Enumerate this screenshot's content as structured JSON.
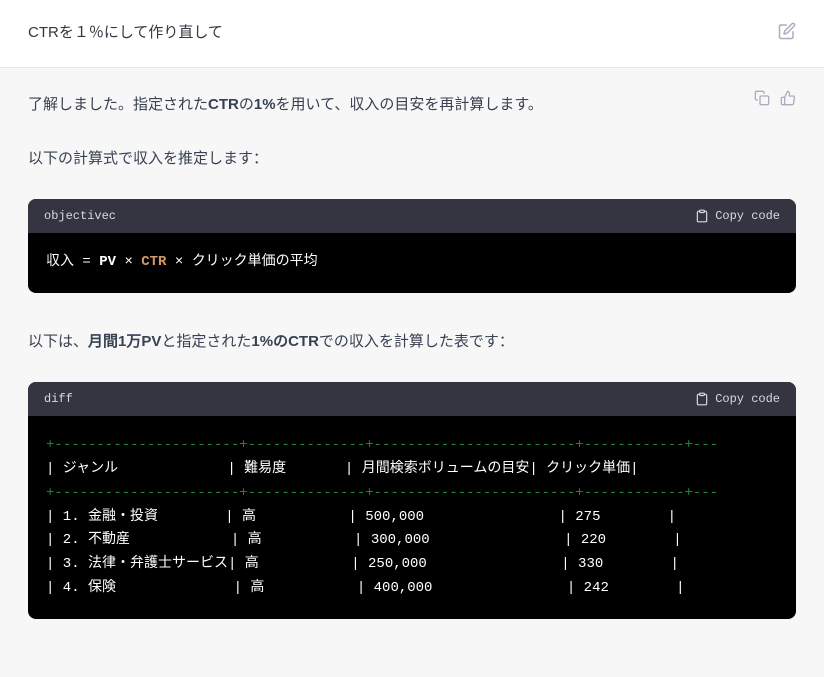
{
  "user": {
    "message": "CTRを１％にして作り直して"
  },
  "assistant": {
    "para1": "了解しました。指定されたCTRの1%を用いて、収入の目安を再計算します。",
    "para2": "以下の計算式で収入を推定します：",
    "para3": "以下は、月間1万PVと指定された1%のCTRでの収入を計算した表です："
  },
  "bold": {
    "ctr": "CTR",
    "one_percent": "1%",
    "pv10k": "月間1万PV",
    "one_percent_ctr": "1%のCTR"
  },
  "code1": {
    "lang": "objectivec",
    "copy": "Copy code",
    "tok_income": "収入",
    "tok_eq": "=",
    "tok_pv": "PV",
    "tok_times1": "×",
    "tok_ctr": "CTR",
    "tok_times2": "×",
    "tok_rest": "クリック単価の平均"
  },
  "code2": {
    "lang": "diff",
    "copy": "Copy code"
  },
  "chart_data": {
    "type": "table",
    "columns": [
      "ジャンル",
      "難易度",
      "月間検索ボリュームの目安",
      "クリック単価"
    ],
    "rows": [
      {
        "no": "1.",
        "genre": "金融・投資",
        "difficulty": "高",
        "volume": "500,000",
        "cpc": "275"
      },
      {
        "no": "2.",
        "genre": "不動産",
        "difficulty": "高",
        "volume": "300,000",
        "cpc": "220"
      },
      {
        "no": "3.",
        "genre": "法律・弁護士サービス",
        "difficulty": "高",
        "volume": "250,000",
        "cpc": "330"
      },
      {
        "no": "4.",
        "genre": "保険",
        "difficulty": "高",
        "volume": "400,000",
        "cpc": "242"
      }
    ]
  }
}
